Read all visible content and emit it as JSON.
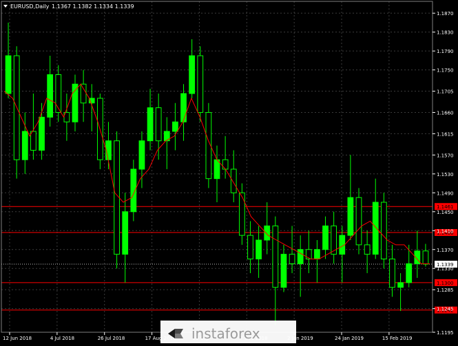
{
  "header": {
    "symbol_label": "EURUSD,Daily",
    "ohlc_label": "1.1367 1.1382 1.1334 1.1339"
  },
  "watermark": {
    "text": "instaforex"
  },
  "colors": {
    "background": "#000000",
    "candle": "#00ff00",
    "moving_average": "#ff0000",
    "level_line": "#ff0000",
    "level_label_bg": "#ff0000",
    "price_tag_bg": "#ffffff",
    "grid": "#3c3c3c",
    "text": "#ffffff",
    "watermark_text": "#9a9a9a"
  },
  "chart_data": {
    "type": "candlestick",
    "x_tick_labels": [
      "12 Jun 2018",
      "4 Jul 2018",
      "26 Jul 2018",
      "17 Aug 2018",
      "10 Sep",
      "7 Dec 2018",
      "2 Jan 2019",
      "24 Jan 2019",
      "15 Feb 2019"
    ],
    "y_tick_labels": [
      "1.1870",
      "1.1830",
      "1.1790",
      "1.1750",
      "1.1705",
      "1.1660",
      "1.1615",
      "1.1570",
      "1.1530",
      "1.1490",
      "1.1450",
      "1.1410",
      "1.1370",
      "1.1330",
      "1.1285",
      "1.1245",
      "1.1195"
    ],
    "ylim": [
      1.1195,
      1.1895
    ],
    "grid": true,
    "levels": [
      {
        "value": 1.1461,
        "label": "1.1461"
      },
      {
        "value": 1.1406,
        "label": "1.1406"
      },
      {
        "value": 1.13,
        "label": "1.1300"
      },
      {
        "value": 1.1242,
        "label": "1.1242"
      }
    ],
    "current_price": {
      "value": 1.1339,
      "label": "1.1339"
    },
    "moving_average": [
      1.1705,
      1.169,
      1.165,
      1.161,
      1.164,
      1.169,
      1.168,
      1.165,
      1.17,
      1.172,
      1.169,
      1.164,
      1.158,
      1.149,
      1.147,
      1.148,
      1.152,
      1.154,
      1.158,
      1.16,
      1.161,
      1.164,
      1.169,
      1.165,
      1.16,
      1.156,
      1.154,
      1.151,
      1.148,
      1.144,
      1.142,
      1.14,
      1.139,
      1.138,
      1.137,
      1.136,
      1.135,
      1.135,
      1.136,
      1.137,
      1.138,
      1.14,
      1.142,
      1.143,
      1.141,
      1.139,
      1.138,
      1.138,
      1.136,
      1.134,
      1.134
    ],
    "candles": [
      {
        "o": 1.17,
        "h": 1.185,
        "l": 1.169,
        "c": 1.178
      },
      {
        "o": 1.178,
        "h": 1.18,
        "l": 1.152,
        "c": 1.156
      },
      {
        "o": 1.156,
        "h": 1.166,
        "l": 1.153,
        "c": 1.162
      },
      {
        "o": 1.162,
        "h": 1.17,
        "l": 1.156,
        "c": 1.158
      },
      {
        "o": 1.158,
        "h": 1.168,
        "l": 1.156,
        "c": 1.165
      },
      {
        "o": 1.165,
        "h": 1.178,
        "l": 1.163,
        "c": 1.174
      },
      {
        "o": 1.174,
        "h": 1.176,
        "l": 1.164,
        "c": 1.166
      },
      {
        "o": 1.166,
        "h": 1.17,
        "l": 1.16,
        "c": 1.164
      },
      {
        "o": 1.164,
        "h": 1.174,
        "l": 1.162,
        "c": 1.172
      },
      {
        "o": 1.172,
        "h": 1.175,
        "l": 1.164,
        "c": 1.168
      },
      {
        "o": 1.168,
        "h": 1.172,
        "l": 1.162,
        "c": 1.169
      },
      {
        "o": 1.169,
        "h": 1.17,
        "l": 1.154,
        "c": 1.156
      },
      {
        "o": 1.156,
        "h": 1.164,
        "l": 1.154,
        "c": 1.16
      },
      {
        "o": 1.16,
        "h": 1.162,
        "l": 1.133,
        "c": 1.136
      },
      {
        "o": 1.136,
        "h": 1.149,
        "l": 1.13,
        "c": 1.145
      },
      {
        "o": 1.145,
        "h": 1.156,
        "l": 1.143,
        "c": 1.154
      },
      {
        "o": 1.154,
        "h": 1.162,
        "l": 1.15,
        "c": 1.16
      },
      {
        "o": 1.16,
        "h": 1.171,
        "l": 1.158,
        "c": 1.167
      },
      {
        "o": 1.167,
        "h": 1.17,
        "l": 1.156,
        "c": 1.16
      },
      {
        "o": 1.16,
        "h": 1.165,
        "l": 1.154,
        "c": 1.162
      },
      {
        "o": 1.162,
        "h": 1.168,
        "l": 1.158,
        "c": 1.164
      },
      {
        "o": 1.164,
        "h": 1.172,
        "l": 1.16,
        "c": 1.17
      },
      {
        "o": 1.17,
        "h": 1.1815,
        "l": 1.169,
        "c": 1.178
      },
      {
        "o": 1.178,
        "h": 1.18,
        "l": 1.164,
        "c": 1.166
      },
      {
        "o": 1.166,
        "h": 1.168,
        "l": 1.15,
        "c": 1.152
      },
      {
        "o": 1.152,
        "h": 1.159,
        "l": 1.147,
        "c": 1.156
      },
      {
        "o": 1.156,
        "h": 1.161,
        "l": 1.152,
        "c": 1.154
      },
      {
        "o": 1.154,
        "h": 1.158,
        "l": 1.147,
        "c": 1.149
      },
      {
        "o": 1.149,
        "h": 1.151,
        "l": 1.138,
        "c": 1.14
      },
      {
        "o": 1.14,
        "h": 1.143,
        "l": 1.132,
        "c": 1.135
      },
      {
        "o": 1.135,
        "h": 1.142,
        "l": 1.131,
        "c": 1.139
      },
      {
        "o": 1.139,
        "h": 1.147,
        "l": 1.136,
        "c": 1.142
      },
      {
        "o": 1.142,
        "h": 1.144,
        "l": 1.121,
        "c": 1.129
      },
      {
        "o": 1.129,
        "h": 1.138,
        "l": 1.128,
        "c": 1.136
      },
      {
        "o": 1.136,
        "h": 1.142,
        "l": 1.132,
        "c": 1.134
      },
      {
        "o": 1.134,
        "h": 1.14,
        "l": 1.127,
        "c": 1.137
      },
      {
        "o": 1.137,
        "h": 1.141,
        "l": 1.132,
        "c": 1.135
      },
      {
        "o": 1.135,
        "h": 1.139,
        "l": 1.13,
        "c": 1.137
      },
      {
        "o": 1.137,
        "h": 1.144,
        "l": 1.135,
        "c": 1.142
      },
      {
        "o": 1.142,
        "h": 1.145,
        "l": 1.134,
        "c": 1.136
      },
      {
        "o": 1.136,
        "h": 1.142,
        "l": 1.13,
        "c": 1.14
      },
      {
        "o": 1.14,
        "h": 1.157,
        "l": 1.139,
        "c": 1.148
      },
      {
        "o": 1.148,
        "h": 1.15,
        "l": 1.136,
        "c": 1.138
      },
      {
        "o": 1.138,
        "h": 1.141,
        "l": 1.132,
        "c": 1.136
      },
      {
        "o": 1.136,
        "h": 1.152,
        "l": 1.135,
        "c": 1.147
      },
      {
        "o": 1.147,
        "h": 1.149,
        "l": 1.133,
        "c": 1.135
      },
      {
        "o": 1.135,
        "h": 1.138,
        "l": 1.127,
        "c": 1.129
      },
      {
        "o": 1.129,
        "h": 1.132,
        "l": 1.124,
        "c": 1.13
      },
      {
        "o": 1.13,
        "h": 1.138,
        "l": 1.129,
        "c": 1.134
      },
      {
        "o": 1.134,
        "h": 1.141,
        "l": 1.131,
        "c": 1.1367
      },
      {
        "o": 1.1367,
        "h": 1.1382,
        "l": 1.1334,
        "c": 1.1339
      }
    ]
  }
}
